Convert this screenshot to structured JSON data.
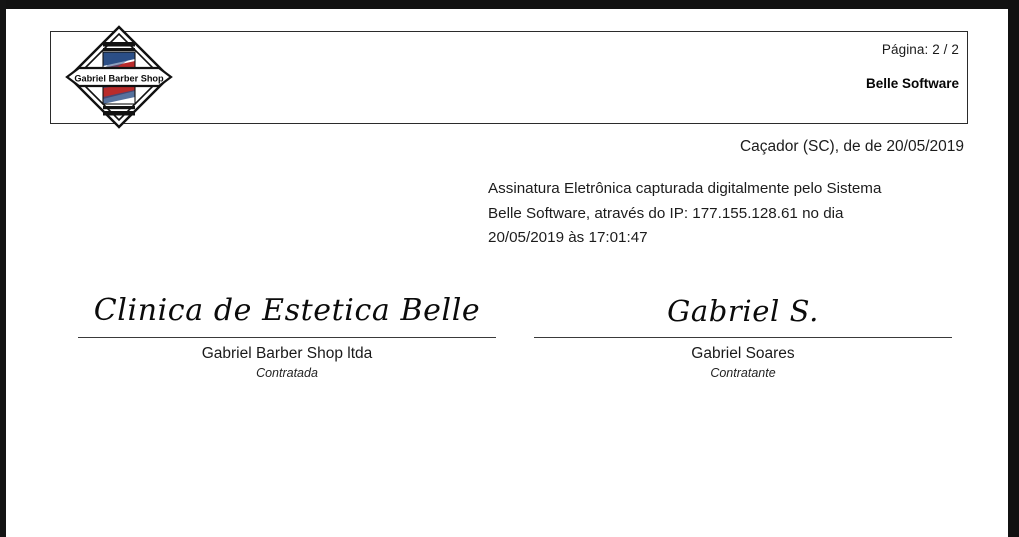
{
  "document": {
    "header": {
      "logo_alt_text": "Gabriel Barber Shop",
      "page_counter": "Página: 2 / 2",
      "brand": "Belle Software"
    },
    "city_date_line": "Caçador (SC),  de  de 20/05/2019",
    "statement": {
      "line1": "Assinatura Eletrônica capturada digitalmente pelo Sistema",
      "line2": "Belle Software, através do IP: 177.155.128.61 no dia",
      "line3": "20/05/2019 às 17:01:47"
    },
    "signatures": [
      {
        "script": "Clinica de Estetica Belle",
        "name": "Gabriel Barber Shop ltda",
        "role": "Contratada"
      },
      {
        "script": "Gabriel S.",
        "name": "Gabriel Soares",
        "role": "Contratante"
      }
    ]
  },
  "colors": {
    "frame": "#121212",
    "text": "#1c1c1c",
    "rule": "#3a3a3a",
    "logo_red": "#b92b2b",
    "logo_blue": "#2c4f86",
    "logo_outline": "#111111"
  }
}
